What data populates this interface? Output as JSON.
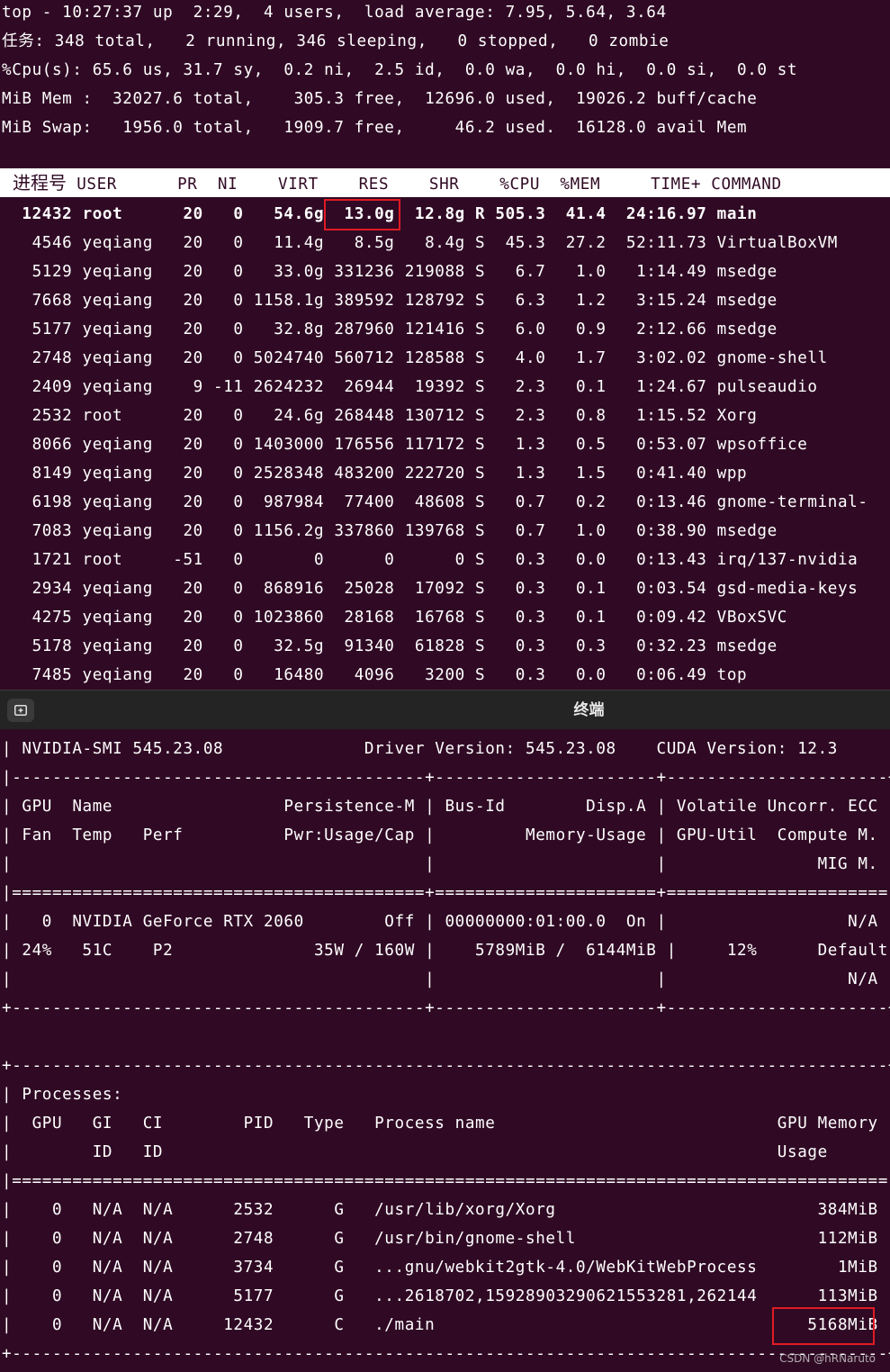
{
  "top": {
    "summary": [
      "top - 10:27:37 up  2:29,  4 users,  load average: 7.95, 5.64, 3.64",
      "任务: 348 total,   2 running, 346 sleeping,   0 stopped,   0 zombie",
      "%Cpu(s): 65.6 us, 31.7 sy,  0.2 ni,  2.5 id,  0.0 wa,  0.0 hi,  0.0 si,  0.0 st",
      "MiB Mem :  32027.6 total,    305.3 free,  12696.0 used,  19026.2 buff/cache",
      "MiB Swap:   1956.0 total,   1909.7 free,     46.2 used.  16128.0 avail Mem"
    ],
    "header_pid": "进程号",
    "header_rest": " USER      PR  NI    VIRT    RES    SHR    %CPU  %MEM     TIME+ COMMAND",
    "processes": [
      "  12432 root      20   0   54.6g  13.0g  12.8g R 505.3  41.4  24:16.97 main",
      "   4546 yeqiang   20   0   11.4g   8.5g   8.4g S  45.3  27.2  52:11.73 VirtualBoxVM",
      "   5129 yeqiang   20   0   33.0g 331236 219088 S   6.7   1.0   1:14.49 msedge",
      "   7668 yeqiang   20   0 1158.1g 389592 128792 S   6.3   1.2   3:15.24 msedge",
      "   5177 yeqiang   20   0   32.8g 287960 121416 S   6.0   0.9   2:12.66 msedge",
      "   2748 yeqiang   20   0 5024740 560712 128588 S   4.0   1.7   3:02.02 gnome-shell",
      "   2409 yeqiang    9 -11 2624232  26944  19392 S   2.3   0.1   1:24.67 pulseaudio",
      "   2532 root      20   0   24.6g 268448 130712 S   2.3   0.8   1:15.52 Xorg",
      "   8066 yeqiang   20   0 1403000 176556 117172 S   1.3   0.5   0:53.07 wpsoffice",
      "   8149 yeqiang   20   0 2528348 483200 222720 S   1.3   1.5   0:41.40 wpp",
      "   6198 yeqiang   20   0  987984  77400  48608 S   0.7   0.2   0:13.46 gnome-terminal-",
      "   7083 yeqiang   20   0 1156.2g 337860 139768 S   0.7   1.0   0:38.90 msedge",
      "   1721 root     -51   0       0      0      0 S   0.3   0.0   0:13.43 irq/137-nvidia",
      "   2934 yeqiang   20   0  868916  25028  17092 S   0.3   0.1   0:03.54 gsd-media-keys",
      "   4275 yeqiang   20   0 1023860  28168  16768 S   0.3   0.1   0:09.42 VBoxSVC",
      "   5178 yeqiang   20   0   32.5g  91340  61828 S   0.3   0.3   0:32.23 msedge",
      "   7485 yeqiang   20   0   16480   4096   3200 S   0.3   0.0   0:06.49 top"
    ]
  },
  "terminal_tab": {
    "title": "终端",
    "icon": "new-tab-icon"
  },
  "nvidia_smi": {
    "lines": [
      "| NVIDIA-SMI 545.23.08              Driver Version: 545.23.08    CUDA Version: 12.3     |",
      "|-----------------------------------------+----------------------+----------------------+",
      "| GPU  Name                 Persistence-M | Bus-Id        Disp.A | Volatile Uncorr. ECC |",
      "| Fan  Temp   Perf          Pwr:Usage/Cap |         Memory-Usage | GPU-Util  Compute M. |",
      "|                                         |                      |               MIG M. |",
      "|=========================================+======================+======================|",
      "|   0  NVIDIA GeForce RTX 2060        Off | 00000000:01:00.0  On |                  N/A |",
      "| 24%   51C    P2              35W / 160W |    5789MiB /  6144MiB |     12%      Default |",
      "|                                         |                      |                  N/A |",
      "+-----------------------------------------+----------------------+----------------------+",
      "",
      "+---------------------------------------------------------------------------------------+",
      "| Processes:                                                                            |",
      "|  GPU   GI   CI        PID   Type   Process name                            GPU Memory |",
      "|        ID   ID                                                             Usage      |",
      "|=======================================================================================|",
      "|    0   N/A  N/A      2532      G   /usr/lib/xorg/Xorg                          384MiB |",
      "|    0   N/A  N/A      2748      G   /usr/bin/gnome-shell                        112MiB |",
      "|    0   N/A  N/A      3734      G   ...gnu/webkit2gtk-4.0/WebKitWebProcess        1MiB |",
      "|    0   N/A  N/A      5177      G   ...2618702,15928903290621553281,262144      113MiB |",
      "|    0   N/A  N/A     12432      C   ./main                                     5168MiB |",
      "+---------------------------------------------------------------------------------------+"
    ]
  },
  "watermark": "CSDN @hRNaruto",
  "colors": {
    "terminal_bg": "#300a24",
    "highlight_box": "#e01b24",
    "header_bg": "#ffffff",
    "tabbar_bg": "#242424"
  }
}
